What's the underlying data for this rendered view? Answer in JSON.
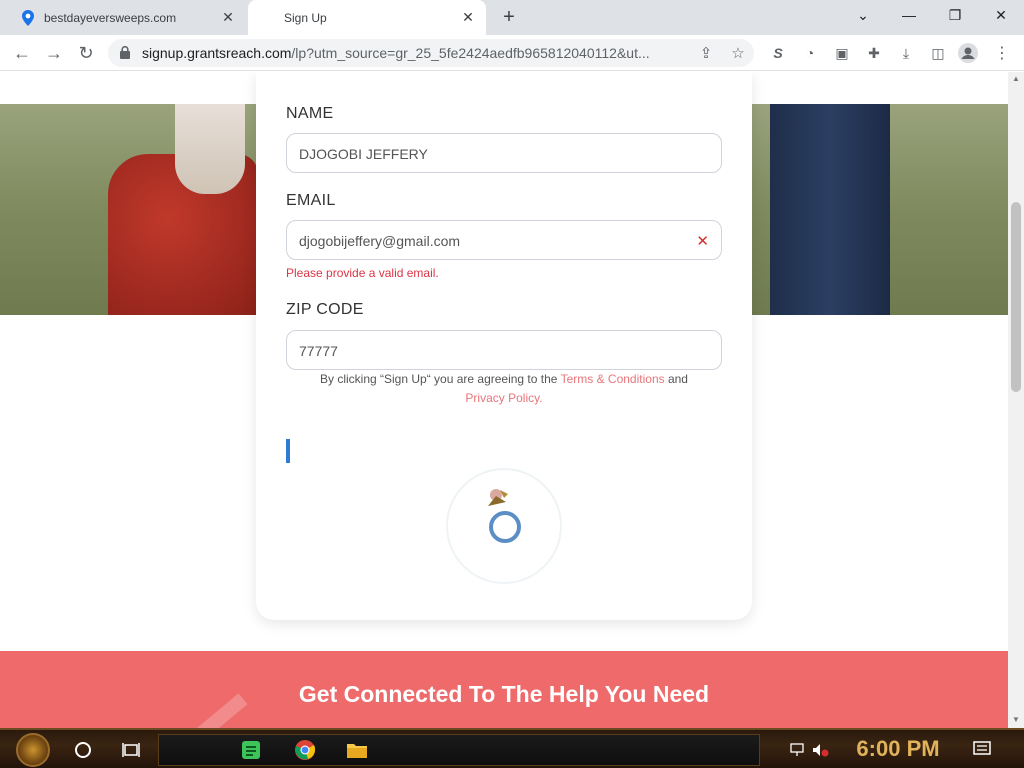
{
  "browser": {
    "tabs": [
      {
        "title": "bestdayeversweeps.com",
        "active": false,
        "favicon": "location-pin-icon"
      },
      {
        "title": "Sign Up",
        "active": true
      }
    ],
    "url_host": "signup.grantsreach.com",
    "url_rest": "/lp?utm_source=gr_25_5fe2424aedfb965812040112&ut..."
  },
  "form": {
    "name_label": "NAME",
    "name_value": "DJOGOBI JEFFERY",
    "email_label": "EMAIL",
    "email_value": "djogobijeffery@gmail.com",
    "email_error": "Please provide a valid email.",
    "zip_label": "ZIP CODE",
    "zip_value": "77777",
    "consent_prefix": "By clicking “Sign Up“ you are agreeing to the ",
    "terms_link": "Terms & Conditions",
    "consent_and": " and",
    "privacy_link": "Privacy Policy.",
    "error_color": "#dc3545"
  },
  "banner": {
    "heading": "Get Connected To The Help You Need",
    "color": "#ef6b6b"
  },
  "taskbar": {
    "clock": "6:00 PM"
  }
}
